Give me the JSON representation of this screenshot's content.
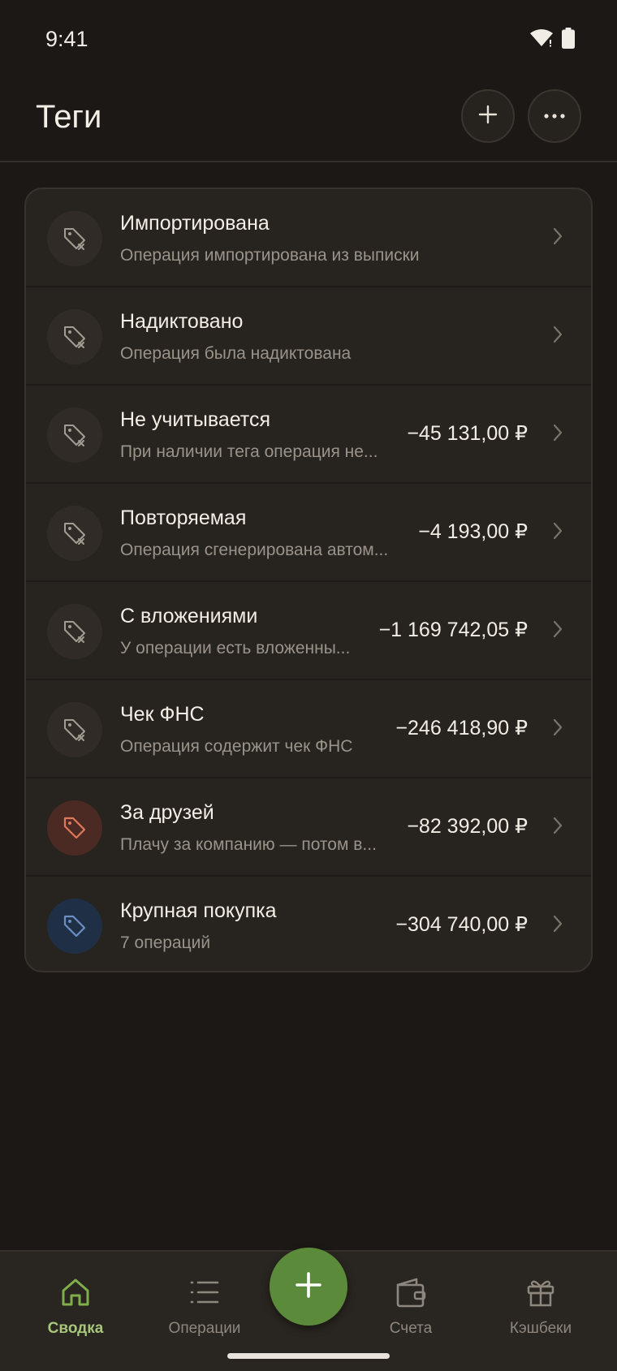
{
  "status": {
    "time": "9:41"
  },
  "header": {
    "title": "Теги"
  },
  "tags": [
    {
      "name": "Импортирована",
      "desc": "Операция импортирована из выписки",
      "amount": "",
      "icon": "tag-off-icon",
      "color": "gray"
    },
    {
      "name": "Надиктовано",
      "desc": "Операция была надиктована",
      "amount": "",
      "icon": "tag-off-icon",
      "color": "gray"
    },
    {
      "name": "Не учитывается",
      "desc": "При наличии тега операция не...",
      "amount": "−45 131,00 ₽",
      "icon": "tag-off-icon",
      "color": "gray"
    },
    {
      "name": "Повторяемая",
      "desc": "Операция сгенерирована автом...",
      "amount": "−4 193,00 ₽",
      "icon": "tag-off-icon",
      "color": "gray"
    },
    {
      "name": "С вложениями",
      "desc": "У операции есть вложенны...",
      "amount": "−1 169 742,05 ₽",
      "icon": "tag-off-icon",
      "color": "gray"
    },
    {
      "name": "Чек ФНС",
      "desc": "Операция содержит чек ФНС",
      "amount": "−246 418,90 ₽",
      "icon": "tag-off-icon",
      "color": "gray"
    },
    {
      "name": "За друзей",
      "desc": "Плачу за компанию — потом в...",
      "amount": "−82 392,00 ₽",
      "icon": "tag-icon",
      "color": "#e0785a"
    },
    {
      "name": "Крупная покупка",
      "desc": "7 операций",
      "amount": "−304 740,00 ₽",
      "icon": "tag-icon",
      "color": "#6a8fc2"
    }
  ],
  "nav": {
    "summary": "Сводка",
    "operations": "Операции",
    "accounts": "Счета",
    "cashback": "Кэшбеки"
  },
  "colors": {
    "accent": "#5a8a3a",
    "active_label": "#a7c77a"
  }
}
